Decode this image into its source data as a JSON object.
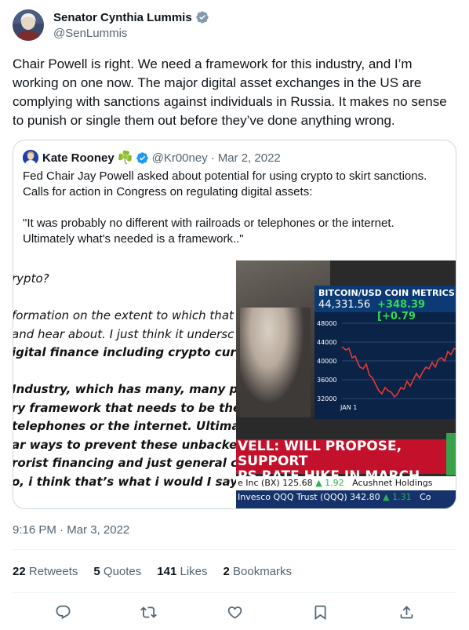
{
  "author": {
    "display_name": "Senator Cynthia Lummis",
    "handle": "@SenLummis",
    "verified_badge_color": "#829aab"
  },
  "tweet": {
    "text": "Chair Powell is right. We need a framework for this industry, and I’m working on one now. The major digital asset exchanges in the US are complying with sanctions against individuals in Russia. It makes no sense to punish or single them out before they’ve done anything wrong."
  },
  "quoted_tweet": {
    "display_name": "Kate Rooney",
    "name_emoji": "☘️",
    "verified_badge_color": "#1d9bf0",
    "handle": "@Kr00ney",
    "separator": "·",
    "date": "Mar 2, 2022",
    "text_para_1": "Fed Chair Jay Powell asked about potential for using crypto to skirt sanctions. Calls for action in Congress on regulating digital assets:",
    "text_para_2": "\"It was probably no different with railroads or telephones or the internet. Ultimately what's needed is a framework..\"",
    "transcript_lines": [
      "rypto?",
      "",
      "formation on the extent to which that",
      "and hear about. I just think it undersc",
      "igital finance including crypto currenc",
      "",
      "Industry, which has many, many parts",
      "ry framework  that needs to be there.",
      "telephones or the internet. Ultimate",
      "ar ways to prevent these unbacked cr",
      "rorist financing and just general crim",
      "o, i think that’s what i would I say the"
    ],
    "tv": {
      "chart_title": "BITCOIN/USD COIN METRICS",
      "price": "44,331.56",
      "change": "+348.39",
      "change_pct": "[+0.79",
      "y_ticks": [
        "48000",
        "44000",
        "40000",
        "36000",
        "32000"
      ],
      "x_tick": "JAN 1",
      "lower_third_1": "VELL: WILL PROPOSE, SUPPORT",
      "lower_third_2": "PS RATE HIKE IN MARCH",
      "ticker_1": "e Inc (BX) 125.68",
      "ticker_1_change": "▲ 1.92",
      "ticker_1_next": "Acushnet Holdings",
      "ticker_2": "Invesco QQQ Trust (QQQ) 342.80",
      "ticker_2_change": "▲ 1.31",
      "ticker_2_next": "Co"
    }
  },
  "meta": {
    "time": "9:16 PM",
    "separator": "·",
    "date": "Mar 3, 2022"
  },
  "stats": {
    "retweets_count": "22",
    "retweets_label": "Retweets",
    "quotes_count": "5",
    "quotes_label": "Quotes",
    "likes_count": "141",
    "likes_label": "Likes",
    "bookmarks_count": "2",
    "bookmarks_label": "Bookmarks"
  },
  "actions": [
    "reply-icon",
    "retweet-icon",
    "like-icon",
    "bookmark-icon",
    "share-icon"
  ],
  "colors": {
    "text": "#0f1419",
    "secondary": "#536471",
    "border": "#cfd9de",
    "divider": "#eff3f4",
    "link_blue": "#1d9bf0"
  }
}
